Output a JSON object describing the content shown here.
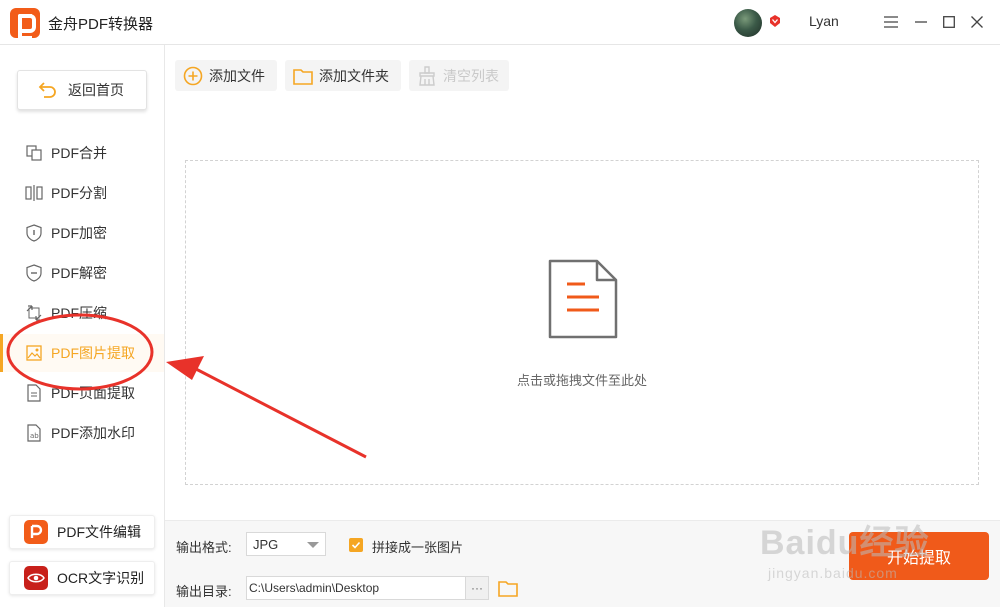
{
  "app": {
    "title": "金舟PDF转换器",
    "username": "Lyan"
  },
  "sidebar": {
    "back_label": "返回首页",
    "items": [
      {
        "label": "PDF合并",
        "icon": "merge-icon"
      },
      {
        "label": "PDF分割",
        "icon": "split-icon"
      },
      {
        "label": "PDF加密",
        "icon": "shield-lock-icon"
      },
      {
        "label": "PDF解密",
        "icon": "shield-unlock-icon"
      },
      {
        "label": "PDF压缩",
        "icon": "compress-icon"
      },
      {
        "label": "PDF图片提取",
        "icon": "image-icon",
        "active": true
      },
      {
        "label": "PDF页面提取",
        "icon": "page-icon"
      },
      {
        "label": "PDF添加水印",
        "icon": "watermark-icon"
      }
    ],
    "bottom": [
      {
        "label": "PDF文件编辑",
        "icon": "pdf-edit-icon"
      },
      {
        "label": "OCR文字识别",
        "icon": "ocr-eye-icon"
      }
    ]
  },
  "toolbar": {
    "add_file": "添加文件",
    "add_folder": "添加文件夹",
    "clear_list": "清空列表"
  },
  "dropzone": {
    "hint": "点击或拖拽文件至此处"
  },
  "output": {
    "format_label": "输出格式:",
    "format_value": "JPG",
    "merge_label": "拼接成一张图片",
    "merge_checked": true,
    "dir_label": "输出目录:",
    "dir_value": "C:\\Users\\admin\\Desktop",
    "more": "···",
    "start_label": "开始提取"
  },
  "watermark": {
    "brand": "Baidu经验",
    "url": "jingyan.baidu.com"
  },
  "colors": {
    "accent": "#f5a623",
    "primary": "#f05a1a",
    "annotation": "#e8322a"
  }
}
